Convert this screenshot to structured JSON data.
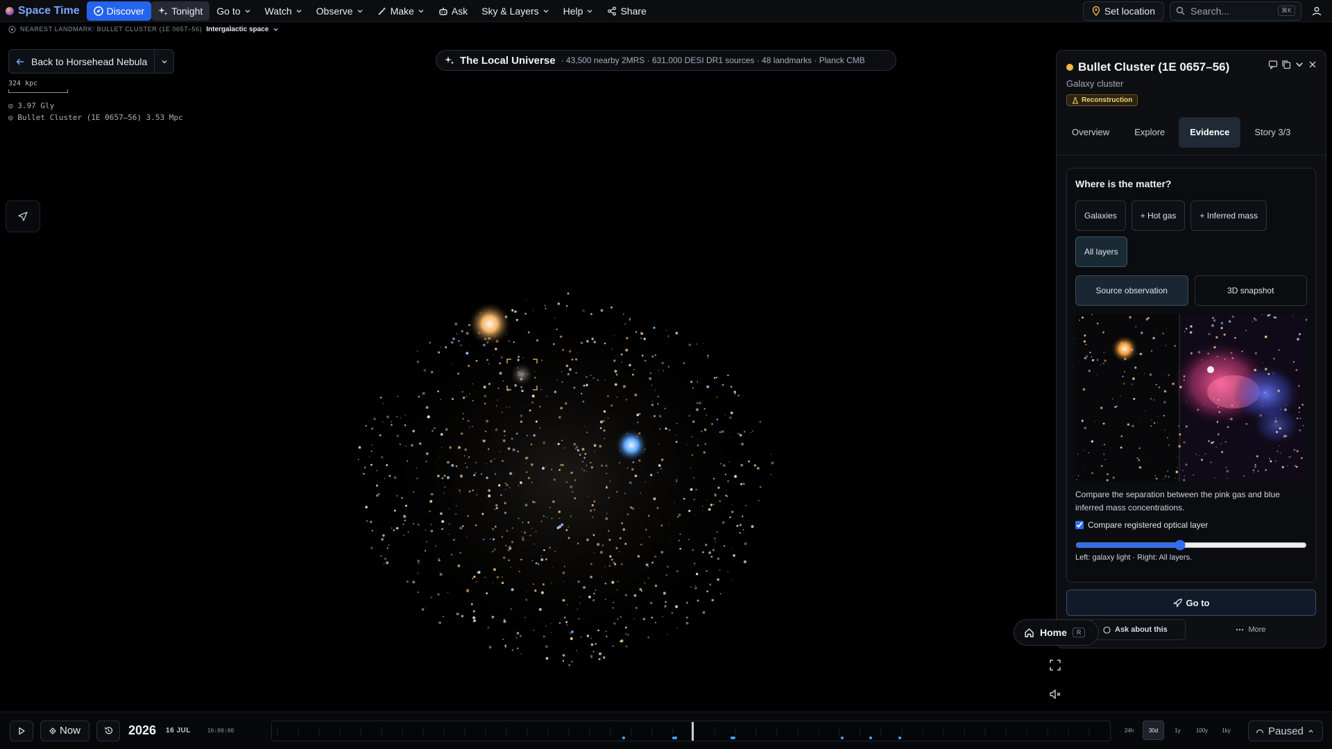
{
  "app": {
    "title": "Space Time"
  },
  "nav": {
    "discover": "Discover",
    "tonight": "Tonight",
    "goto": "Go to",
    "watch": "Watch",
    "observe": "Observe",
    "make": "Make",
    "ask": "Ask",
    "sky_layers": "Sky & Layers",
    "help": "Help",
    "share": "Share",
    "set_location": "Set location",
    "search_placeholder": "Search...",
    "search_shortcut": "⌘K"
  },
  "landmark": {
    "label": "NEAREST LANDMARK: BULLET CLUSTER (1E 0657–56)",
    "zone": "Intergalactic space"
  },
  "back": {
    "label": "Back to Horsehead Nebula"
  },
  "scale": {
    "label": "324 kpc"
  },
  "readouts": {
    "distance": "◎ 3.97 Gly",
    "target": "◎ Bullet Cluster (1E 0657–56) 3.53 Mpc"
  },
  "scene": {
    "title": "The Local Universe",
    "summary": "· 43,500 nearby 2MRS · 631,000 DESI DR1 sources · 48 landmarks · Planck CMB"
  },
  "panel": {
    "title": "Bullet Cluster (1E 0657–56)",
    "subtitle": "Galaxy cluster",
    "badge": "Reconstruction",
    "tabs": [
      "Overview",
      "Explore",
      "Evidence",
      "Story 3/3"
    ],
    "active_tab": "Evidence",
    "card_title": "Where is the matter?",
    "chips": [
      "Galaxies",
      "+ Hot gas",
      "+ Inferred mass",
      "All layers"
    ],
    "active_chip": "All layers",
    "views": [
      "Source observation",
      "3D snapshot"
    ],
    "active_view": "Source observation",
    "description": "Compare the separation between the pink gas and blue inferred mass concentrations.",
    "checkbox_label": "Compare registered optical layer",
    "checkbox_checked": true,
    "slider_value": 45,
    "slider_caption": "Left: galaxy light · Right: All layers.",
    "goto_label": "Go to",
    "ask_label": "Ask about this",
    "more_label": "More"
  },
  "home": {
    "label": "Home",
    "shortcut": "R"
  },
  "timeline": {
    "now_label": "Now",
    "year": "2026",
    "date": "16 JUL",
    "time": "16:00:00",
    "ranges": [
      "24h",
      "30d",
      "1y",
      "100y",
      "1ky"
    ],
    "active_range": "30d",
    "status": "Paused"
  },
  "colors": {
    "accent": "#2463eb",
    "badge": "#f5d37a",
    "active_tab": "#1f2a36",
    "marker": "#4aa6ff"
  }
}
